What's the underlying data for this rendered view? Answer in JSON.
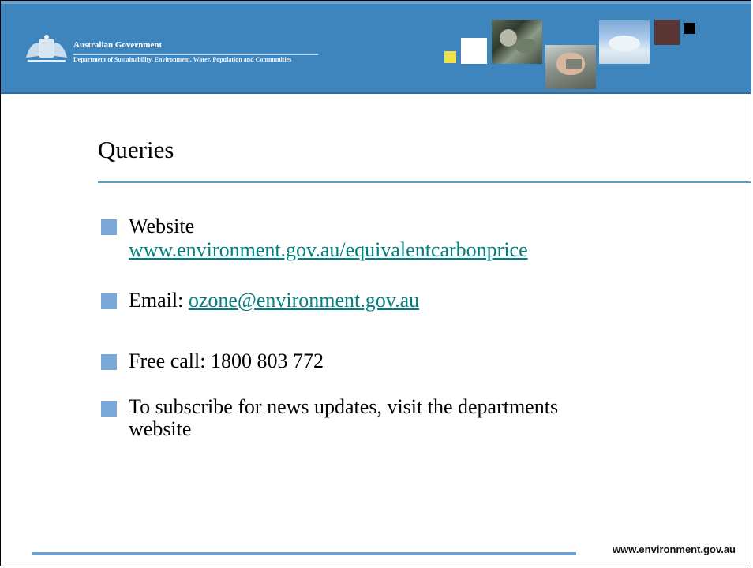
{
  "header": {
    "org_name": "Australian Government",
    "department": "Department of Sustainability, Environment, Water, Population and Communities"
  },
  "slide": {
    "title": "Queries",
    "bullets": [
      {
        "line1": "Website",
        "line2": "www.environment.gov.au/equivalentcarbonprice"
      },
      {
        "label": "Email: ",
        "link": "ozone@environment.gov.au"
      },
      {
        "text": "Free call: 1800 803 772"
      },
      {
        "line1": "To subscribe for news updates, visit the departments",
        "line2": "website"
      }
    ]
  },
  "footer": {
    "url": "www.environment.gov.au"
  },
  "colors": {
    "header_blue": "#3e84bd",
    "bullet_marker": "#7aa9d8",
    "link": "#008080",
    "rule": "#5f9cc7"
  }
}
